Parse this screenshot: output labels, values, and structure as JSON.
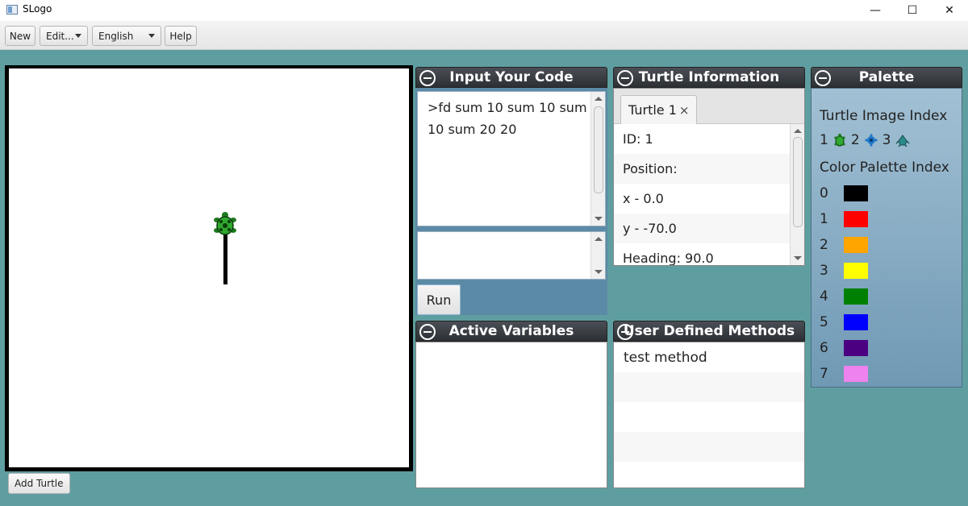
{
  "window": {
    "title": "SLogo",
    "minimize": "—",
    "maximize": "☐",
    "close": "✕"
  },
  "toolbar": {
    "new_label": "New",
    "edit_label": "Edit...",
    "language_value": "English",
    "help_label": "Help"
  },
  "canvas": {
    "add_turtle_label": "Add Turtle"
  },
  "input_panel": {
    "title": "Input Your Code",
    "code_text": ">fd sum 10 sum 10 sum 10 sum 20 20",
    "entry_text": "",
    "run_label": "Run"
  },
  "turtle_info": {
    "title": "Turtle Information",
    "tab_label": "Turtle 1",
    "tab_close": "×",
    "rows": [
      "ID: 1",
      "Position:",
      "x - 0.0",
      "y - -70.0",
      "Heading: 90.0"
    ]
  },
  "variables_panel": {
    "title": "Active Variables",
    "items": []
  },
  "methods_panel": {
    "title": "User Defined Methods",
    "items": [
      "test method"
    ]
  },
  "palette": {
    "title": "Palette",
    "image_index_heading": "Turtle Image Index",
    "image_indices": [
      "1",
      "2",
      "3"
    ],
    "color_index_heading": "Color Palette Index",
    "colors": [
      {
        "index": "0",
        "color": "#000000"
      },
      {
        "index": "1",
        "color": "#ff0000"
      },
      {
        "index": "2",
        "color": "#ffa500"
      },
      {
        "index": "3",
        "color": "#ffff00"
      },
      {
        "index": "4",
        "color": "#008000"
      },
      {
        "index": "5",
        "color": "#0000ff"
      },
      {
        "index": "6",
        "color": "#4b0082"
      },
      {
        "index": "7",
        "color": "#ee82ee"
      }
    ]
  },
  "colors": {
    "background": "#5f9ea0",
    "panel_header": "#2c3035"
  }
}
